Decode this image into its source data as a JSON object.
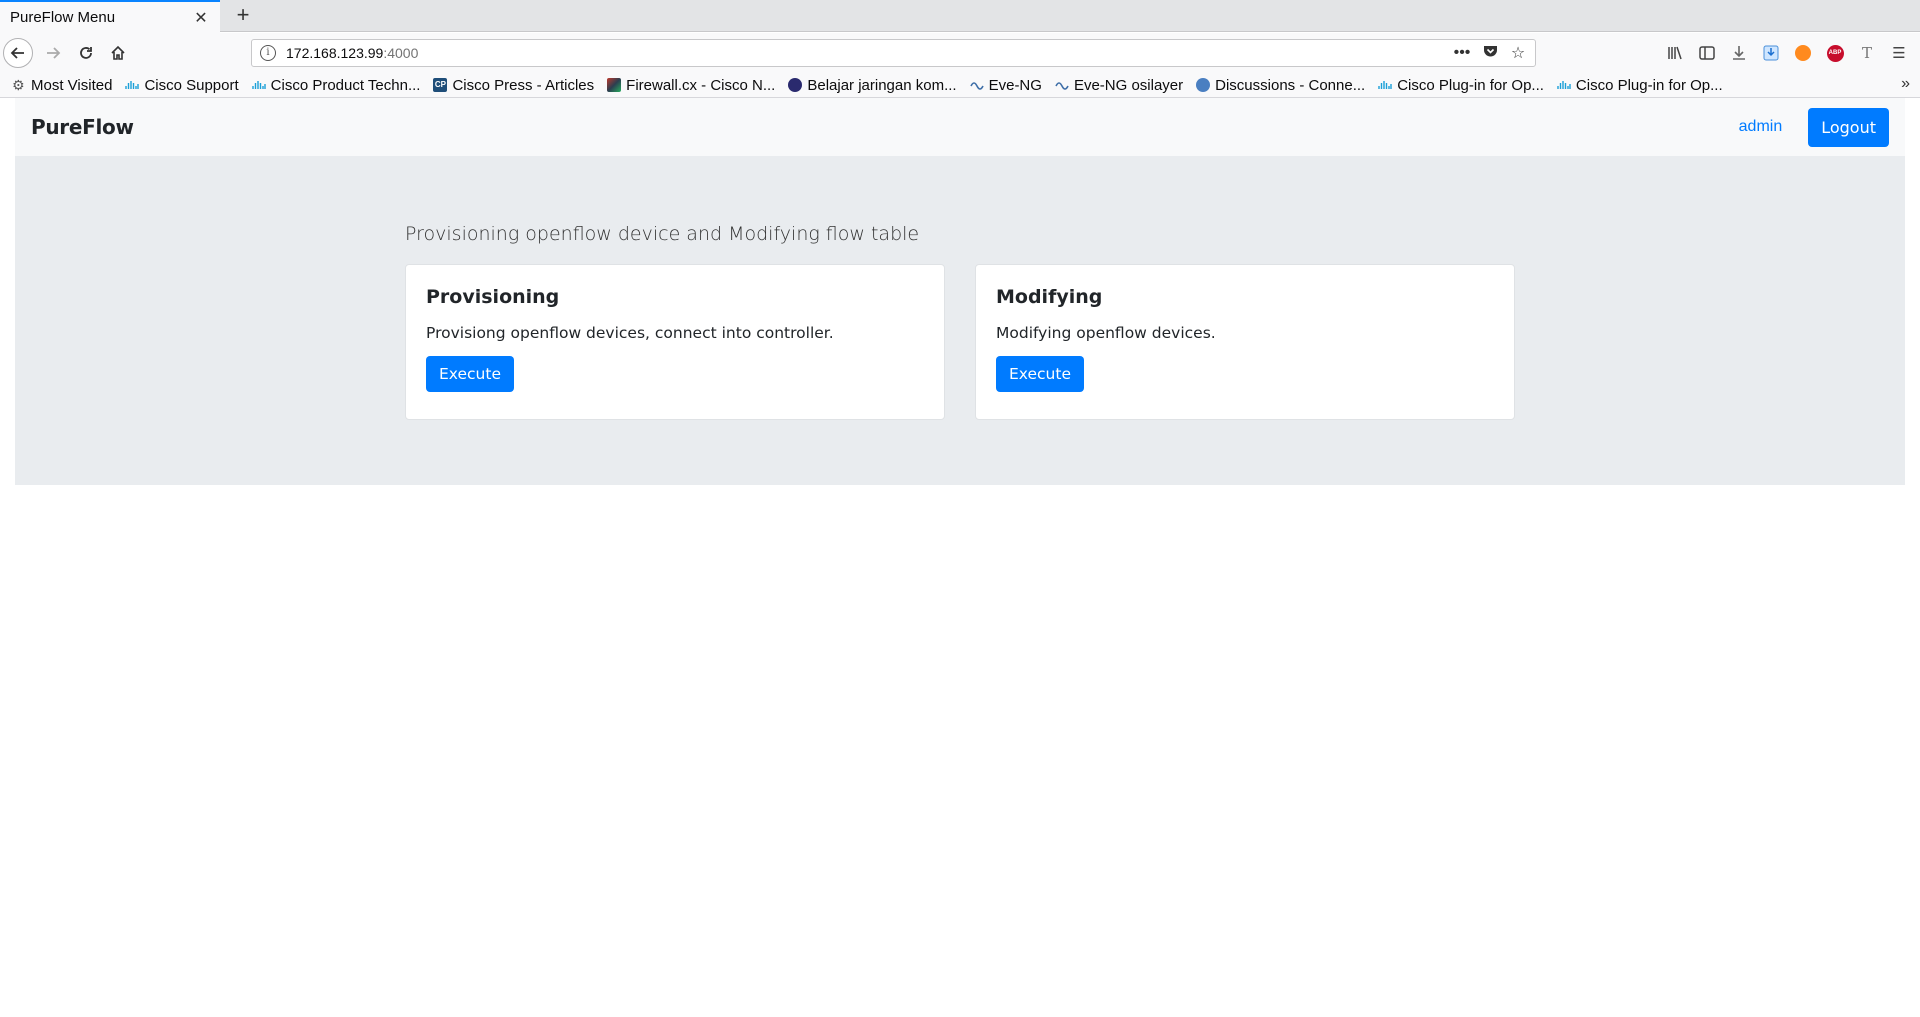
{
  "browser": {
    "tab_title": "PureFlow Menu",
    "url_host": "172.168.123.99",
    "url_port": ":4000",
    "bookmarks": [
      {
        "label": "Most Visited",
        "icon": "gear-icon",
        "color": "#555555"
      },
      {
        "label": "Cisco Support",
        "icon": "cisco-icon",
        "color": "#1ba0d7"
      },
      {
        "label": "Cisco Product Techn...",
        "icon": "cisco-icon",
        "color": "#1ba0d7"
      },
      {
        "label": "Cisco Press - Articles",
        "icon": "cp-icon",
        "color": "#1f4e79"
      },
      {
        "label": "Firewall.cx - Cisco N...",
        "icon": "firewall-icon",
        "color": "#8b2b2b"
      },
      {
        "label": "Belajar jaringan kom...",
        "icon": "globe-icon",
        "color": "#2a2a6e"
      },
      {
        "label": "Eve-NG",
        "icon": "eve-icon",
        "color": "#3f6fa8"
      },
      {
        "label": "Eve-NG osilayer",
        "icon": "eve-icon",
        "color": "#3f6fa8"
      },
      {
        "label": "Discussions - Conne...",
        "icon": "globe-icon",
        "color": "#4a7fc1"
      },
      {
        "label": "Cisco Plug-in for Op...",
        "icon": "cisco-icon",
        "color": "#1ba0d7"
      },
      {
        "label": "Cisco Plug-in for Op...",
        "icon": "cisco-icon",
        "color": "#1ba0d7"
      }
    ]
  },
  "app": {
    "brand": "PureFlow",
    "user": "admin",
    "logout_label": "Logout",
    "accent_color": "#007bff",
    "lead": "Provisioning openflow device and Modifying flow table",
    "cards": [
      {
        "title": "Provisioning",
        "text": "Provisiong openflow devices, connect into controller.",
        "button": "Execute"
      },
      {
        "title": "Modifying",
        "text": "Modifying openflow devices.",
        "button": "Execute"
      }
    ]
  }
}
